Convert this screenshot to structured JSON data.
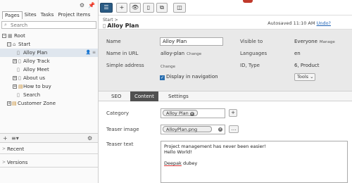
{
  "left": {
    "tabs": [
      {
        "label": "Pages",
        "active": true
      },
      {
        "label": "Sites",
        "active": false
      },
      {
        "label": "Tasks",
        "active": false
      },
      {
        "label": "Project Items",
        "active": false
      }
    ],
    "search_placeholder": "Search",
    "tree": [
      {
        "label": "Root",
        "depth": 0,
        "expander": "minus",
        "icon": "root-icon",
        "selected": false
      },
      {
        "label": "Start",
        "depth": 1,
        "expander": "minus",
        "icon": "home-icon",
        "selected": false
      },
      {
        "label": "Alloy Plan",
        "depth": 2,
        "expander": "none",
        "icon": "page-icon",
        "selected": true
      },
      {
        "label": "Alloy Track",
        "depth": 2,
        "expander": "plus",
        "icon": "page-icon",
        "selected": false
      },
      {
        "label": "Alloy Meet",
        "depth": 2,
        "expander": "none",
        "icon": "page-icon",
        "selected": false
      },
      {
        "label": "About us",
        "depth": 2,
        "expander": "plus",
        "icon": "page-icon",
        "selected": false
      },
      {
        "label": "How to buy",
        "depth": 2,
        "expander": "plus",
        "icon": "folder-icon",
        "selected": false
      },
      {
        "label": "Search",
        "depth": 2,
        "expander": "none",
        "icon": "page-icon",
        "selected": false
      },
      {
        "label": "Customer Zone",
        "depth": 1,
        "expander": "plus",
        "icon": "folder-icon",
        "selected": false
      }
    ],
    "gadgets": [
      "Recent",
      "Versions"
    ]
  },
  "header": {
    "breadcrumb": "Start",
    "title": "Alloy Plan",
    "autosave": "Autosaved 11:10 AM",
    "undo": "Undo?"
  },
  "props": {
    "name_label": "Name",
    "name_value": "Alloy Plan",
    "url_label": "Name in URL",
    "url_value": "alloy-plan",
    "change": "Change",
    "simple_label": "Simple address",
    "nav_label": "Display in navigation",
    "visible_label": "Visible to",
    "visible_value": "Everyone",
    "manage": "Manage",
    "lang_label": "Languages",
    "lang_value": "en",
    "id_label": "ID, Type",
    "id_value": "6, Product",
    "tools": "Tools"
  },
  "content_tabs": [
    {
      "label": "SEO",
      "active": false
    },
    {
      "label": "Content",
      "active": true
    },
    {
      "label": "Settings",
      "active": false
    }
  ],
  "form": {
    "category_label": "Category",
    "category_value": "Alloy Plan",
    "teaser_image_label": "Teaser image",
    "teaser_image_value": "AlloyPlan.png",
    "teaser_text_label": "Teaser text",
    "teaser_line1": "Project management has never been easier!",
    "teaser_line2": "Hello World!",
    "teaser_sig_first": "Deepak",
    "teaser_sig_last": "dubey"
  }
}
